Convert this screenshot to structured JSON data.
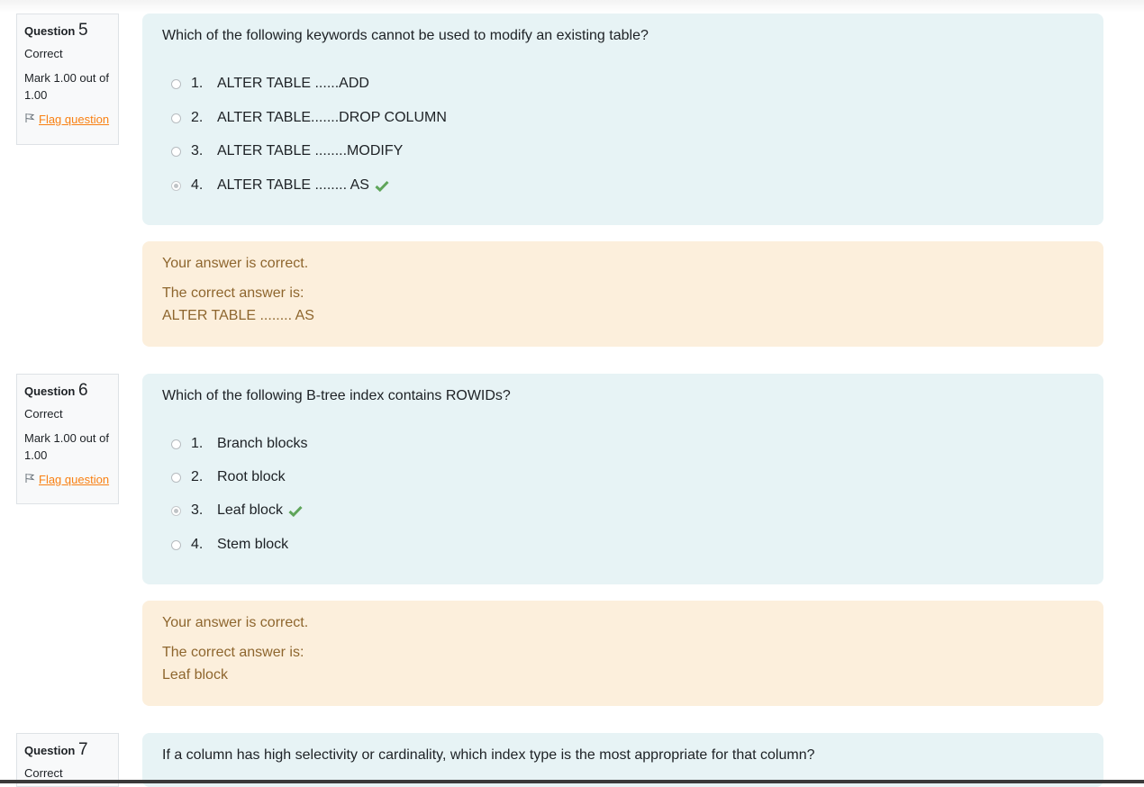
{
  "questions": [
    {
      "label": "Question",
      "number": "5",
      "state": "Correct",
      "grade": "Mark 1.00 out of 1.00",
      "flag_label": "Flag question",
      "text": "Which of the following keywords cannot be used to modify an existing table?",
      "options": [
        {
          "num": "1.",
          "label": "ALTER TABLE ......ADD",
          "selected": false,
          "correct": false
        },
        {
          "num": "2.",
          "label": "ALTER TABLE.......DROP COLUMN",
          "selected": false,
          "correct": false
        },
        {
          "num": "3.",
          "label": "ALTER TABLE ........MODIFY",
          "selected": false,
          "correct": false
        },
        {
          "num": "4.",
          "label": "ALTER TABLE ........ AS",
          "selected": true,
          "correct": true
        }
      ],
      "feedback": {
        "result": "Your answer is correct.",
        "correct_answer_heading": "The correct answer is:",
        "correct_answer": "ALTER TABLE ........ AS"
      }
    },
    {
      "label": "Question",
      "number": "6",
      "state": "Correct",
      "grade": "Mark 1.00 out of 1.00",
      "flag_label": "Flag question",
      "text": "Which of the following B-tree index contains ROWIDs?",
      "options": [
        {
          "num": "1.",
          "label": "Branch blocks",
          "selected": false,
          "correct": false
        },
        {
          "num": "2.",
          "label": "Root block",
          "selected": false,
          "correct": false
        },
        {
          "num": "3.",
          "label": "Leaf block",
          "selected": true,
          "correct": true
        },
        {
          "num": "4.",
          "label": "Stem block",
          "selected": false,
          "correct": false
        }
      ],
      "feedback": {
        "result": "Your answer is correct.",
        "correct_answer_heading": "The correct answer is:",
        "correct_answer": "Leaf block"
      }
    },
    {
      "label": "Question",
      "number": "7",
      "state": "Correct",
      "text": "If a column has high selectivity or cardinality, which index type is the most appropriate for that column?"
    }
  ],
  "colors": {
    "formulation_bg": "#e7f3f5",
    "feedback_bg": "#fcefdc",
    "feedback_text": "#8e662e",
    "flag_link": "#f98012",
    "check_mark": "#5fa55a"
  },
  "icons": {
    "flag": "flag-icon",
    "correct": "check-icon"
  }
}
